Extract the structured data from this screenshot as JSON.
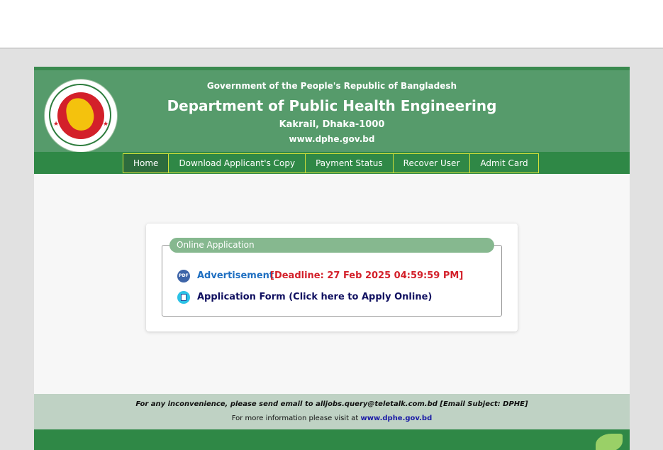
{
  "header": {
    "gov_line": "Government of the People's Republic of Bangladesh",
    "department": "Department of Public Health Engineering",
    "address": "Kakrail, Dhaka-1000",
    "website": "www.dphe.gov.bd",
    "logo_icon": "bangladesh-government-seal"
  },
  "nav": {
    "items": [
      {
        "label": "Home",
        "active": true
      },
      {
        "label": "Download Applicant's Copy"
      },
      {
        "label": "Payment Status"
      },
      {
        "label": "Recover User"
      },
      {
        "label": "Admit Card"
      }
    ]
  },
  "panel": {
    "legend": "Online Application",
    "advertisement_label": "Advertisement",
    "deadline": "[Deadline: 27 Feb 2025 04:59:59 PM]",
    "application_form_label": "Application Form (Click here to Apply Online)",
    "advertisement_icon": "pdf-icon",
    "form_icon": "form-icon"
  },
  "footer": {
    "contact_text": "For any inconvenience, please send email to alljobs.query@teletalk.com.bd [Email Subject: DPHE]",
    "more_info_prefix": "For more information please visit at",
    "more_info_link": "www.dphe.gov.bd"
  },
  "colors": {
    "header_green": "#569b6b",
    "nav_green": "#2f8846",
    "deadline_red": "#d3202a",
    "link_blue": "#1f6fc1"
  }
}
